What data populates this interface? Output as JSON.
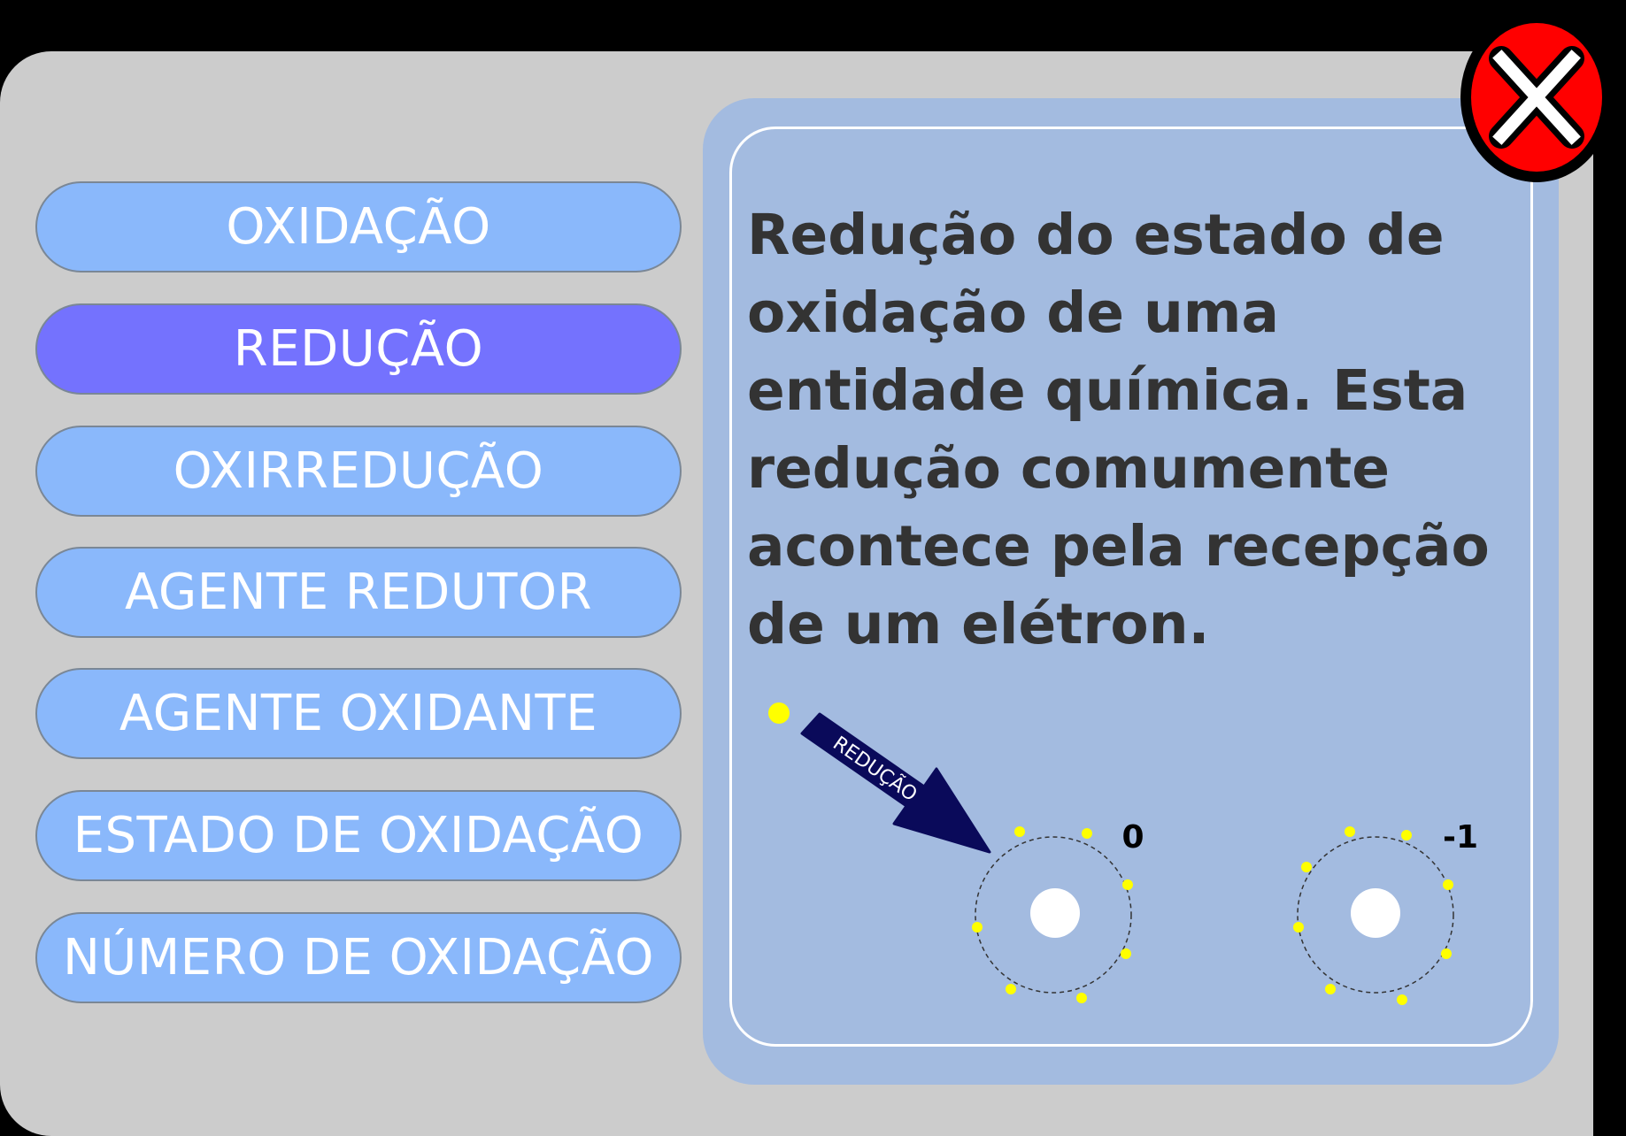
{
  "menu": {
    "items": [
      {
        "label": "OXIDAÇÃO",
        "active": false
      },
      {
        "label": "REDUÇÃO",
        "active": true
      },
      {
        "label": "OXIRREDUÇÃO",
        "active": false
      },
      {
        "label": "AGENTE REDUTOR",
        "active": false
      },
      {
        "label": "AGENTE OXIDANTE",
        "active": false
      },
      {
        "label": "ESTADO DE OXIDAÇÃO",
        "active": false
      },
      {
        "label": "NÚMERO DE OXIDAÇÃO",
        "active": false
      }
    ]
  },
  "definition": {
    "text": "Redução do estado de oxidação de uma entidade química. Esta redução comumente acontece pela recepção de um elétron."
  },
  "diagram": {
    "arrow_label": "REDUÇÃO",
    "atom_before_charge": "0",
    "atom_after_charge": "-1"
  },
  "icons": {
    "close": "close-icon"
  },
  "colors": {
    "button": "#8ab8fb",
    "button_active": "#7472fe",
    "panel": "#a3bbe0",
    "arrow": "#0a0a5a",
    "electron": "#ffff00",
    "close_red": "#ff0000"
  }
}
